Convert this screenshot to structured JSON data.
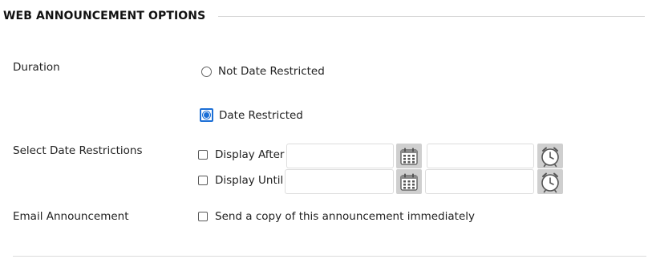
{
  "section": {
    "title": "WEB ANNOUNCEMENT OPTIONS"
  },
  "duration": {
    "label": "Duration",
    "options": [
      {
        "label": "Not Date Restricted",
        "selected": false
      },
      {
        "label": "Date Restricted",
        "selected": true
      }
    ]
  },
  "date_restrictions": {
    "label": "Select Date Restrictions",
    "display_after": {
      "label": "Display After",
      "checked": false,
      "date_value": "",
      "time_value": "",
      "date_icon": "calendar-icon",
      "time_icon": "clock-icon"
    },
    "display_until": {
      "label": "Display Until",
      "checked": false,
      "date_value": "",
      "time_value": "",
      "date_icon": "calendar-icon",
      "time_icon": "clock-icon"
    }
  },
  "email": {
    "label": "Email Announcement",
    "option_label": "Send a copy of this announcement immediately",
    "checked": false
  },
  "colors": {
    "accent": "#1c6fd6",
    "icon_button_bg": "#cfcfcf",
    "rule": "#d6d6d6"
  }
}
